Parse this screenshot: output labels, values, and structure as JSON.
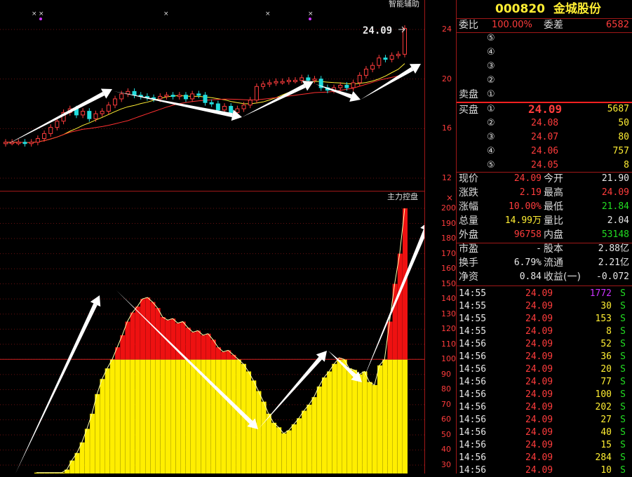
{
  "stock": {
    "code": "000820",
    "name": "金城股份"
  },
  "panels": {
    "top_title": "智能辅助",
    "bottom_title": "主力控盘",
    "close_icon": "close-icon"
  },
  "price_annotation": "24.09",
  "axis_top": [
    "24",
    "20",
    "16",
    "12"
  ],
  "axis_bottom": [
    "200",
    "190",
    "180",
    "170",
    "160",
    "150",
    "140",
    "130",
    "120",
    "110",
    "100",
    "90",
    "80",
    "70",
    "60",
    "50",
    "40",
    "30"
  ],
  "weibi": {
    "label": "委比",
    "value": "100.00%",
    "diff_label": "委差",
    "diff_value": "6582"
  },
  "sell": {
    "label": "卖盘",
    "levels": [
      "⑤",
      "④",
      "③",
      "②",
      "①"
    ]
  },
  "buy": {
    "label": "买盘",
    "rows": [
      {
        "level": "①",
        "price": "24.09",
        "vol": "5687"
      },
      {
        "level": "②",
        "price": "24.08",
        "vol": "50"
      },
      {
        "level": "③",
        "price": "24.07",
        "vol": "80"
      },
      {
        "level": "④",
        "price": "24.06",
        "vol": "757"
      },
      {
        "level": "⑤",
        "price": "24.05",
        "vol": "8"
      }
    ]
  },
  "quote": [
    {
      "l1": "现价",
      "v1": "24.09",
      "l2": "今开",
      "v2": "21.90",
      "c1": "red",
      "c2": "white"
    },
    {
      "l1": "涨跌",
      "v1": "2.19",
      "l2": "最高",
      "v2": "24.09",
      "c1": "red",
      "c2": "red"
    },
    {
      "l1": "涨幅",
      "v1": "10.00%",
      "l2": "最低",
      "v2": "21.84",
      "c1": "red",
      "c2": "green"
    },
    {
      "l1": "总量",
      "v1": "14.99万",
      "l2": "量比",
      "v2": "2.04",
      "c1": "yellow",
      "c2": "white"
    },
    {
      "l1": "外盘",
      "v1": "96758",
      "l2": "内盘",
      "v2": "53148",
      "c1": "red",
      "c2": "green"
    }
  ],
  "finance": [
    {
      "l1": "市盈",
      "v1": "-",
      "l2": "股本",
      "v2": "2.88亿"
    },
    {
      "l1": "换手",
      "v1": "6.79%",
      "l2": "流通",
      "v2": "2.21亿"
    },
    {
      "l1": "净资",
      "v1": "0.84",
      "l2": "收益(一)",
      "v2": "-0.072"
    }
  ],
  "ticks": [
    {
      "t": "14:55",
      "p": "24.09",
      "v": "1772",
      "s": "S",
      "vc": "magenta"
    },
    {
      "t": "14:55",
      "p": "24.09",
      "v": "30",
      "s": "S",
      "vc": "yellow"
    },
    {
      "t": "14:55",
      "p": "24.09",
      "v": "153",
      "s": "S",
      "vc": "yellow"
    },
    {
      "t": "14:55",
      "p": "24.09",
      "v": "8",
      "s": "S",
      "vc": "yellow"
    },
    {
      "t": "14:56",
      "p": "24.09",
      "v": "52",
      "s": "S",
      "vc": "yellow"
    },
    {
      "t": "14:56",
      "p": "24.09",
      "v": "36",
      "s": "S",
      "vc": "yellow"
    },
    {
      "t": "14:56",
      "p": "24.09",
      "v": "20",
      "s": "S",
      "vc": "yellow"
    },
    {
      "t": "14:56",
      "p": "24.09",
      "v": "77",
      "s": "S",
      "vc": "yellow"
    },
    {
      "t": "14:56",
      "p": "24.09",
      "v": "100",
      "s": "S",
      "vc": "yellow"
    },
    {
      "t": "14:56",
      "p": "24.09",
      "v": "202",
      "s": "S",
      "vc": "yellow"
    },
    {
      "t": "14:56",
      "p": "24.09",
      "v": "27",
      "s": "S",
      "vc": "yellow"
    },
    {
      "t": "14:56",
      "p": "24.09",
      "v": "40",
      "s": "S",
      "vc": "yellow"
    },
    {
      "t": "14:56",
      "p": "24.09",
      "v": "15",
      "s": "S",
      "vc": "yellow"
    },
    {
      "t": "14:56",
      "p": "24.09",
      "v": "284",
      "s": "S",
      "vc": "yellow"
    },
    {
      "t": "14:56",
      "p": "24.09",
      "v": "10",
      "s": "S",
      "vc": "yellow"
    }
  ],
  "colors": {
    "up": "#ff3c3c",
    "down": "#22dddd",
    "bar_red": "#ee1111",
    "bar_yellow": "#ffee00",
    "grid": "#a01818"
  },
  "chart_data": [
    {
      "type": "candlestick",
      "title": "智能辅助",
      "ylim": [
        12,
        25
      ],
      "yticks": [
        24,
        20,
        16,
        12
      ],
      "candles_close": [
        14.9,
        14.9,
        14.9,
        14.8,
        14.9,
        15.2,
        15.6,
        16.1,
        16.6,
        17.3,
        17.6,
        17.1,
        17.4,
        16.8,
        17.2,
        17.4,
        17.9,
        18.4,
        18.8,
        19.0,
        18.7,
        18.6,
        18.5,
        18.4,
        18.6,
        18.7,
        18.6,
        18.7,
        18.4,
        18.8,
        18.7,
        18.1,
        18.0,
        17.5,
        17.8,
        17.3,
        17.6,
        17.9,
        18.3,
        19.4,
        19.6,
        19.7,
        19.8,
        19.8,
        19.9,
        19.9,
        20.1,
        19.9,
        20.0,
        19.3,
        19.1,
        19.3,
        19.5,
        19.3,
        19.7,
        20.3,
        20.8,
        21.1,
        21.7,
        21.6,
        21.9,
        22.0,
        24.09
      ],
      "annotation": "24.09"
    },
    {
      "type": "bar",
      "title": "主力控盘",
      "ylim": [
        25,
        205
      ],
      "yticks": [
        200,
        190,
        180,
        170,
        160,
        150,
        140,
        130,
        120,
        110,
        100,
        90,
        80,
        70,
        60,
        50,
        40,
        30
      ],
      "baseline": 100,
      "values": [
        14,
        11,
        16,
        18,
        18,
        22,
        27,
        33,
        38,
        45,
        54,
        64,
        77,
        87,
        94,
        100,
        108,
        116,
        125,
        131,
        135,
        140,
        141,
        138,
        134,
        128,
        126,
        127,
        124,
        125,
        121,
        118,
        119,
        116,
        117,
        113,
        108,
        105,
        106,
        103,
        100,
        97,
        92,
        86,
        79,
        72,
        64,
        58,
        55,
        51,
        53,
        57,
        61,
        66,
        70,
        75,
        82,
        88,
        92,
        97,
        101,
        100,
        94,
        93,
        90,
        92,
        85,
        83,
        96,
        100,
        125,
        150,
        170,
        200
      ]
    }
  ]
}
